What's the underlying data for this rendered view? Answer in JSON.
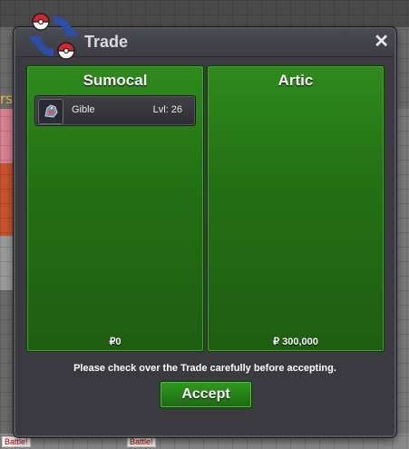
{
  "window": {
    "title": "Trade",
    "close_label": "✕"
  },
  "background": {
    "side_text": "rse",
    "battle_tags": [
      "Battle!",
      "Battle!"
    ]
  },
  "left_panel": {
    "player_name": "Sumocal",
    "money": "₽0",
    "pokemon": [
      {
        "name": "Gible",
        "level": "Lvl: 26",
        "icon": "gible-icon"
      }
    ]
  },
  "right_panel": {
    "player_name": "Artic",
    "money": "₽ 300,000",
    "pokemon": []
  },
  "notice": "Please check over the Trade carefully before accepting.",
  "accept_label": "Accept",
  "colors": {
    "panel_green": "#257015",
    "window_bg": "#3a3a40",
    "accept_green": "#2f9a1f"
  }
}
